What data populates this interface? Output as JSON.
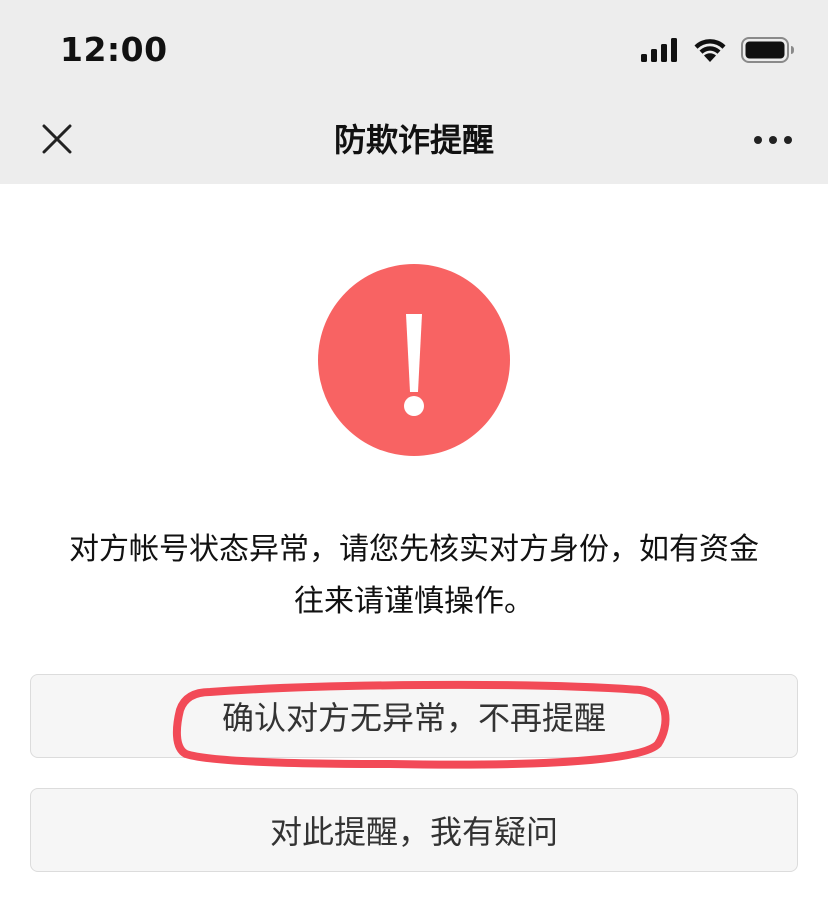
{
  "status_bar": {
    "time": "12:00",
    "icons": [
      "signal-icon",
      "wifi-icon",
      "battery-icon"
    ]
  },
  "nav": {
    "title": "防欺诈提醒",
    "close_icon": "close-icon",
    "more_icon": "more-icon"
  },
  "warning": {
    "icon": "exclamation-icon",
    "color": "#f86363"
  },
  "message": {
    "line1": "对方帐号状态异常，请您先核实对方身份，如有资金",
    "line2": "往来请谨慎操作。"
  },
  "buttons": {
    "confirm_label": "确认对方无异常，不再提醒",
    "question_label": "对此提醒，我有疑问"
  },
  "annotation": {
    "highlight_color": "#f24a57"
  }
}
